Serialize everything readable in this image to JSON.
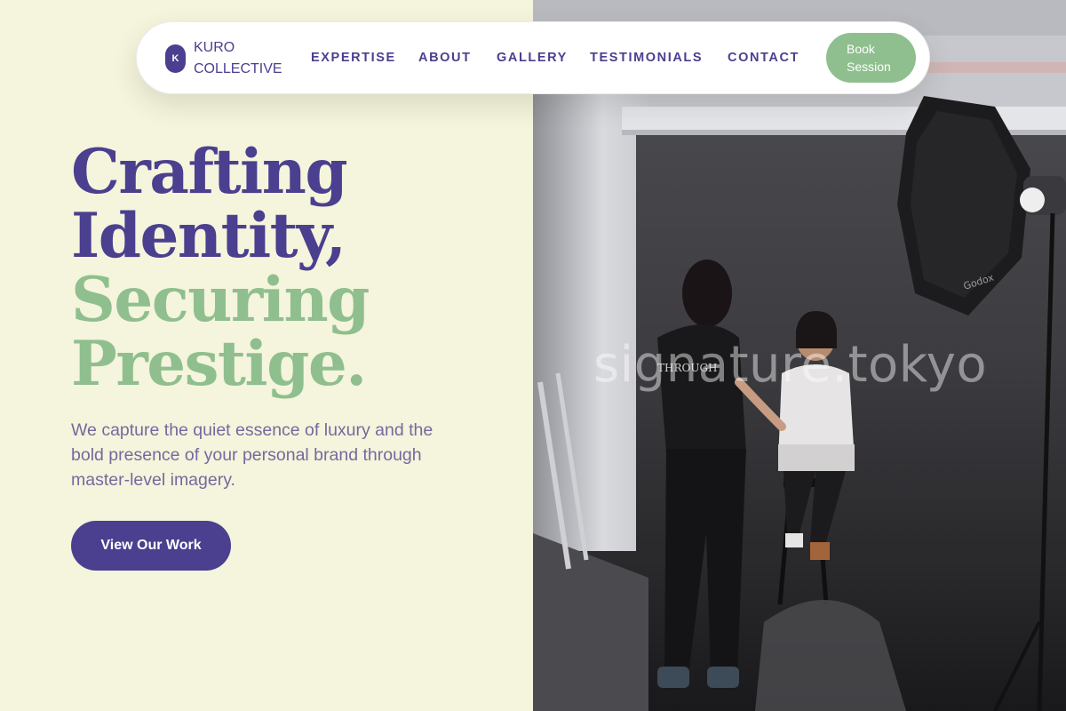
{
  "brand": {
    "mark": "K",
    "name": "KURO COLLECTIVE"
  },
  "nav": {
    "links": [
      "EXPERTISE",
      "ABOUT",
      "GALLERY",
      "TESTIMONIALS",
      "CONTACT"
    ],
    "cta_label": "Book Session"
  },
  "hero": {
    "headline_lines": [
      "Crafting",
      "Identity,",
      "Securing",
      "Prestige."
    ],
    "subtitle": "We capture the quiet essence of luxury and the bold presence of your personal brand through master-level imagery.",
    "button_label": "View Our Work"
  },
  "photo": {
    "watermark": "signature.tokyo",
    "softbox_brand": "Godox"
  },
  "colors": {
    "purple": "#4b3f8f",
    "green": "#8fbf8e",
    "cream": "#f5f4dc",
    "body_text": "#736a9f"
  }
}
